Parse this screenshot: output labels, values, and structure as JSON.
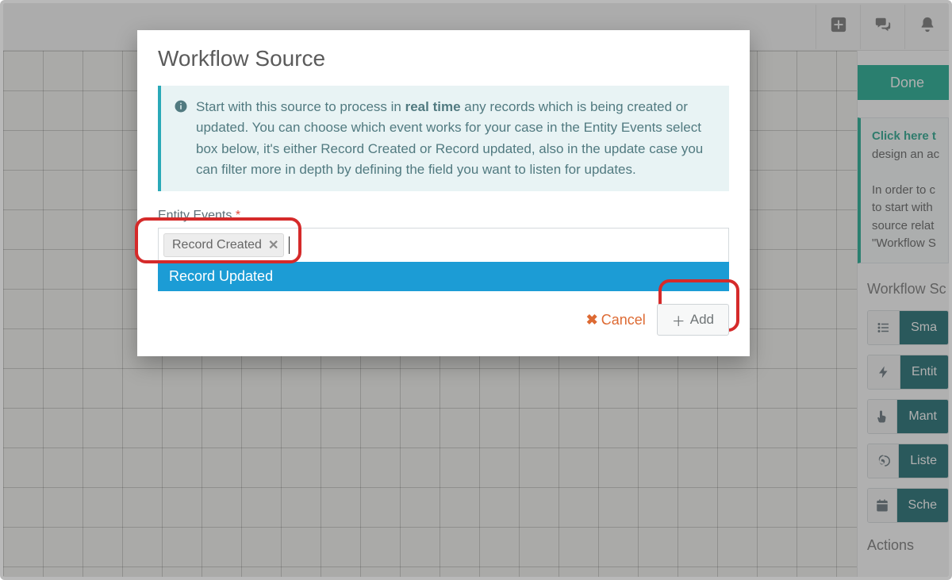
{
  "topbar": {
    "add_icon": "plus",
    "chat_icon": "chat",
    "bell_icon": "bell"
  },
  "buttons": {
    "done": "Done"
  },
  "sidepanel": {
    "hint_link": "Click here t",
    "hint_line1": "design an ac",
    "hint_line2": "In order to c",
    "hint_line3": "to start with",
    "hint_line4": "source relat",
    "hint_line5": "\"Workflow S",
    "sources_heading": "Workflow Sc",
    "actions_heading": "Actions",
    "items": [
      {
        "label": "Sma"
      },
      {
        "label": "Entit"
      },
      {
        "label": "Mant"
      },
      {
        "label": "Liste"
      },
      {
        "label": "Sche"
      }
    ]
  },
  "modal": {
    "title": "Workflow Source",
    "info_prefix": "Start with this source to process in ",
    "info_bold": "real time",
    "info_rest": " any records which is being created or updated. You can choose which event works for your case in the Entity Events select box below, it's either Record Created or Record updated, also in the update case you can filter more in depth by defining the field you want to listen for updates.",
    "field_label": "Entity Events",
    "required_mark": " *",
    "chip": "Record Created",
    "option": "Record Updated",
    "cancel": "Cancel",
    "add": "Add"
  }
}
